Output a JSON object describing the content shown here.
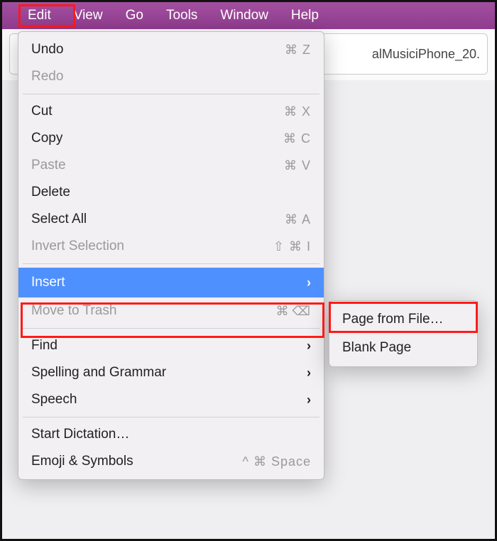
{
  "menubar": {
    "items": [
      "Edit",
      "View",
      "Go",
      "Tools",
      "Window",
      "Help"
    ]
  },
  "tab": {
    "title": "alMusiciPhone_20."
  },
  "editMenu": {
    "undo": {
      "label": "Undo",
      "shortcut": "⌘ Z"
    },
    "redo": {
      "label": "Redo",
      "shortcut": ""
    },
    "cut": {
      "label": "Cut",
      "shortcut": "⌘ X"
    },
    "copy": {
      "label": "Copy",
      "shortcut": "⌘ C"
    },
    "paste": {
      "label": "Paste",
      "shortcut": "⌘ V"
    },
    "delete": {
      "label": "Delete",
      "shortcut": ""
    },
    "selectAll": {
      "label": "Select All",
      "shortcut": "⌘ A"
    },
    "invertSel": {
      "label": "Invert Selection",
      "shortcut": "⇧ ⌘ I"
    },
    "insert": {
      "label": "Insert",
      "shortcut": ""
    },
    "moveTrash": {
      "label": "Move to Trash",
      "shortcut": "⌘"
    },
    "find": {
      "label": "Find",
      "shortcut": ""
    },
    "spelling": {
      "label": "Spelling and Grammar",
      "shortcut": ""
    },
    "speech": {
      "label": "Speech",
      "shortcut": ""
    },
    "dictation": {
      "label": "Start Dictation…",
      "shortcut": ""
    },
    "emoji": {
      "label": "Emoji & Symbols",
      "shortcut": "^ ⌘ Space"
    }
  },
  "insertSubmenu": {
    "pageFromFile": {
      "label": "Page from File…"
    },
    "blankPage": {
      "label": "Blank Page"
    }
  }
}
